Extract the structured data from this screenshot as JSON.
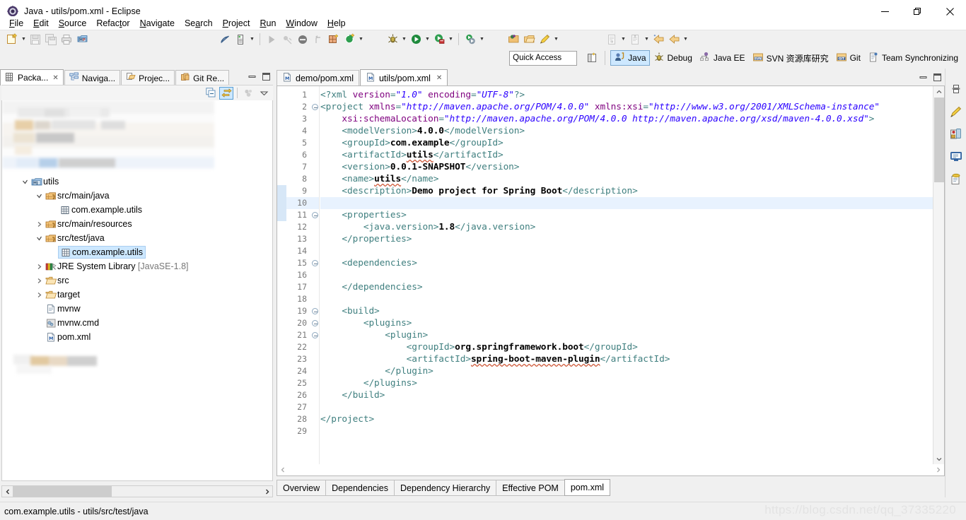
{
  "window": {
    "title": "Java - utils/pom.xml - Eclipse",
    "app_icon": "eclipse-icon",
    "controls": {
      "minimize": "—",
      "maximize": "❐",
      "close": "✕"
    }
  },
  "menubar": {
    "items": [
      {
        "label": "File",
        "mnemonic": "F"
      },
      {
        "label": "Edit",
        "mnemonic": "E"
      },
      {
        "label": "Source",
        "mnemonic": "S"
      },
      {
        "label": "Refactor",
        "mnemonic": "t"
      },
      {
        "label": "Navigate",
        "mnemonic": "N"
      },
      {
        "label": "Search",
        "mnemonic": "a"
      },
      {
        "label": "Project",
        "mnemonic": "P"
      },
      {
        "label": "Run",
        "mnemonic": "R"
      },
      {
        "label": "Window",
        "mnemonic": "W"
      },
      {
        "label": "Help",
        "mnemonic": "H"
      }
    ]
  },
  "toolbar": {
    "items": [
      "new-wizard-icon",
      "new-wizard-dropdown",
      "save-icon",
      "save-all-icon",
      "print-icon",
      "maven-build-icon",
      "toggle-breadcrumb-icon",
      "toggle-mark-occurrences-icon",
      "mark-occurrences-dropdown",
      "run-icon",
      "debug-last-icon",
      "terminate-icon",
      "skip-breakpoints-icon",
      "new-java-package-icon",
      "new-java-project-icon",
      "new-java-dropdown",
      "debug-icon",
      "debug-dropdown",
      "run-play-icon",
      "run-dropdown",
      "coverage-icon",
      "coverage-dropdown",
      "external-tools-icon",
      "external-tools-dropdown",
      "open-type-icon",
      "open-task-icon",
      "open-resource-icon",
      "search-dropdown",
      "next-annotation-icon",
      "next-annotation-dropdown",
      "previous-annotation-icon",
      "previous-annotation-dropdown",
      "back-icon",
      "forward-icon",
      "forward-dropdown"
    ]
  },
  "quick_access": {
    "placeholder": "Quick Access",
    "value": "Quick Access"
  },
  "perspectives": {
    "open_perspective_icon": "open-perspective-icon",
    "items": [
      {
        "label": "Java",
        "icon": "java-perspective-icon",
        "active": true
      },
      {
        "label": "Debug",
        "icon": "debug-perspective-icon",
        "active": false
      },
      {
        "label": "Java EE",
        "icon": "javaee-perspective-icon",
        "active": false
      },
      {
        "label": "SVN 资源库研究",
        "icon": "svn-perspective-icon",
        "active": false
      },
      {
        "label": "Git",
        "icon": "git-perspective-icon",
        "active": false
      },
      {
        "label": "Team Synchronizing",
        "icon": "team-sync-perspective-icon",
        "active": false
      }
    ]
  },
  "left_view": {
    "tabs": [
      {
        "label": "Packa...",
        "icon": "package-explorer-icon",
        "active": true,
        "closable": true
      },
      {
        "label": "Naviga...",
        "icon": "navigator-icon",
        "active": false,
        "closable": false
      },
      {
        "label": "Projec...",
        "icon": "project-explorer-icon",
        "active": false,
        "closable": false
      },
      {
        "label": "Git Re...",
        "icon": "git-repositories-icon",
        "active": false,
        "closable": false
      }
    ],
    "window_buttons": [
      "minimize-view-icon",
      "maximize-view-icon"
    ],
    "toolbar": [
      {
        "name": "collapse-all-icon",
        "active": false
      },
      {
        "name": "link-with-editor-icon",
        "active": true
      },
      {
        "name": "focus-on-active-task-icon",
        "active": false
      },
      {
        "name": "view-menu-icon",
        "active": false
      }
    ],
    "tree": [
      {
        "label": "utils",
        "icon": "maven-project-icon",
        "indent": 1,
        "expander": "expanded",
        "selected": false
      },
      {
        "label": "src/main/java",
        "icon": "source-folder-icon",
        "indent": 2,
        "expander": "expanded",
        "selected": false
      },
      {
        "label": "com.example.utils",
        "icon": "package-icon",
        "indent": 3,
        "expander": "none",
        "selected": false
      },
      {
        "label": "src/main/resources",
        "icon": "source-folder-icon",
        "indent": 2,
        "expander": "collapsed",
        "selected": false
      },
      {
        "label": "src/test/java",
        "icon": "source-folder-icon",
        "indent": 2,
        "expander": "expanded",
        "selected": false
      },
      {
        "label": "com.example.utils",
        "icon": "package-icon",
        "indent": 3,
        "expander": "none",
        "selected": true
      },
      {
        "label": "JRE System Library",
        "suffix": " [JavaSE-1.8]",
        "icon": "jre-library-icon",
        "indent": 2,
        "expander": "collapsed",
        "selected": false
      },
      {
        "label": "src",
        "icon": "folder-icon",
        "indent": 2,
        "expander": "collapsed",
        "selected": false
      },
      {
        "label": "target",
        "icon": "folder-icon",
        "indent": 2,
        "expander": "collapsed",
        "selected": false
      },
      {
        "label": "mvnw",
        "icon": "file-icon",
        "indent": 2,
        "expander": "none",
        "selected": false
      },
      {
        "label": "mvnw.cmd",
        "icon": "cmd-file-icon",
        "indent": 2,
        "expander": "none",
        "selected": false
      },
      {
        "label": "pom.xml",
        "icon": "maven-pom-icon",
        "indent": 2,
        "expander": "none",
        "selected": false
      }
    ],
    "hscroll": {
      "name": "horizontal-scrollbar",
      "left_arrow": "‹",
      "right_arrow": "›"
    }
  },
  "editor": {
    "tabs": [
      {
        "label": "demo/pom.xml",
        "icon": "maven-pom-icon",
        "active": false,
        "closable": false
      },
      {
        "label": "utils/pom.xml",
        "icon": "maven-pom-icon",
        "active": true,
        "closable": true
      }
    ],
    "window_buttons": [
      "minimize-editor-icon",
      "maximize-editor-icon"
    ],
    "current_line": 10,
    "lines": [
      {
        "n": 1,
        "fold": false,
        "tokens": [
          {
            "t": "pi",
            "v": "<?xml "
          },
          {
            "t": "attr",
            "v": "version"
          },
          {
            "t": "pi",
            "v": "="
          },
          {
            "t": "val",
            "v": "\"1.0\""
          },
          {
            "t": "pi",
            "v": " "
          },
          {
            "t": "attr",
            "v": "encoding"
          },
          {
            "t": "pi",
            "v": "="
          },
          {
            "t": "val",
            "v": "\"UTF-8\""
          },
          {
            "t": "pi",
            "v": "?>"
          }
        ]
      },
      {
        "n": 2,
        "fold": true,
        "tokens": [
          {
            "t": "tag",
            "v": "<project "
          },
          {
            "t": "attr",
            "v": "xmlns"
          },
          {
            "t": "tag",
            "v": "="
          },
          {
            "t": "val",
            "v": "\"http://maven.apache.org/POM/4.0.0\""
          },
          {
            "t": "tag",
            "v": " "
          },
          {
            "t": "attr",
            "v": "xmlns:xsi"
          },
          {
            "t": "tag",
            "v": "="
          },
          {
            "t": "val",
            "v": "\"http://www.w3.org/2001/XMLSchema-instance\""
          }
        ]
      },
      {
        "n": 3,
        "fold": false,
        "tokens": [
          {
            "t": "plain",
            "v": "    "
          },
          {
            "t": "attr",
            "v": "xsi:schemaLocation"
          },
          {
            "t": "tag",
            "v": "="
          },
          {
            "t": "val",
            "v": "\"http://maven.apache.org/POM/4.0.0 http://maven.apache.org/xsd/maven-4.0.0.xsd\""
          },
          {
            "t": "tag",
            "v": ">"
          }
        ]
      },
      {
        "n": 4,
        "fold": false,
        "tokens": [
          {
            "t": "plain",
            "v": "    "
          },
          {
            "t": "tag",
            "v": "<modelVersion>"
          },
          {
            "t": "txt",
            "v": "4.0.0"
          },
          {
            "t": "tag",
            "v": "</modelVersion>"
          }
        ]
      },
      {
        "n": 5,
        "fold": false,
        "tokens": [
          {
            "t": "plain",
            "v": "    "
          },
          {
            "t": "tag",
            "v": "<groupId>"
          },
          {
            "t": "txt",
            "v": "com.example"
          },
          {
            "t": "tag",
            "v": "</groupId>"
          }
        ]
      },
      {
        "n": 6,
        "fold": false,
        "tokens": [
          {
            "t": "plain",
            "v": "    "
          },
          {
            "t": "tag",
            "v": "<artifactId>"
          },
          {
            "t": "txt-spell",
            "v": "utils"
          },
          {
            "t": "tag",
            "v": "</artifactId>"
          }
        ]
      },
      {
        "n": 7,
        "fold": false,
        "tokens": [
          {
            "t": "plain",
            "v": "    "
          },
          {
            "t": "tag",
            "v": "<version>"
          },
          {
            "t": "txt",
            "v": "0.0.1-SNAPSHOT"
          },
          {
            "t": "tag",
            "v": "</version>"
          }
        ]
      },
      {
        "n": 8,
        "fold": false,
        "tokens": [
          {
            "t": "plain",
            "v": "    "
          },
          {
            "t": "tag",
            "v": "<name>"
          },
          {
            "t": "txt-spell",
            "v": "utils"
          },
          {
            "t": "tag",
            "v": "</name>"
          }
        ]
      },
      {
        "n": 9,
        "fold": false,
        "tokens": [
          {
            "t": "plain",
            "v": "    "
          },
          {
            "t": "tag",
            "v": "<description>"
          },
          {
            "t": "txt",
            "v": "Demo project for Spring Boot"
          },
          {
            "t": "tag",
            "v": "</description>"
          }
        ]
      },
      {
        "n": 10,
        "fold": false,
        "tokens": []
      },
      {
        "n": 11,
        "fold": true,
        "tokens": [
          {
            "t": "plain",
            "v": "    "
          },
          {
            "t": "tag",
            "v": "<properties>"
          }
        ]
      },
      {
        "n": 12,
        "fold": false,
        "tokens": [
          {
            "t": "plain",
            "v": "        "
          },
          {
            "t": "tag",
            "v": "<java.version>"
          },
          {
            "t": "txt",
            "v": "1.8"
          },
          {
            "t": "tag",
            "v": "</java.version>"
          }
        ]
      },
      {
        "n": 13,
        "fold": false,
        "tokens": [
          {
            "t": "plain",
            "v": "    "
          },
          {
            "t": "tag",
            "v": "</properties>"
          }
        ]
      },
      {
        "n": 14,
        "fold": false,
        "tokens": []
      },
      {
        "n": 15,
        "fold": true,
        "tokens": [
          {
            "t": "plain",
            "v": "    "
          },
          {
            "t": "tag",
            "v": "<dependencies>"
          }
        ]
      },
      {
        "n": 16,
        "fold": false,
        "tokens": []
      },
      {
        "n": 17,
        "fold": false,
        "tokens": [
          {
            "t": "plain",
            "v": "    "
          },
          {
            "t": "tag",
            "v": "</dependencies>"
          }
        ]
      },
      {
        "n": 18,
        "fold": false,
        "tokens": []
      },
      {
        "n": 19,
        "fold": true,
        "tokens": [
          {
            "t": "plain",
            "v": "    "
          },
          {
            "t": "tag",
            "v": "<build>"
          }
        ]
      },
      {
        "n": 20,
        "fold": true,
        "tokens": [
          {
            "t": "plain",
            "v": "        "
          },
          {
            "t": "tag",
            "v": "<plugins>"
          }
        ]
      },
      {
        "n": 21,
        "fold": true,
        "tokens": [
          {
            "t": "plain",
            "v": "            "
          },
          {
            "t": "tag",
            "v": "<plugin>"
          }
        ]
      },
      {
        "n": 22,
        "fold": false,
        "tokens": [
          {
            "t": "plain",
            "v": "                "
          },
          {
            "t": "tag",
            "v": "<groupId>"
          },
          {
            "t": "txt",
            "v": "org.springframework.boot"
          },
          {
            "t": "tag",
            "v": "</groupId>"
          }
        ]
      },
      {
        "n": 23,
        "fold": false,
        "tokens": [
          {
            "t": "plain",
            "v": "                "
          },
          {
            "t": "tag",
            "v": "<artifactId>"
          },
          {
            "t": "txt-spell",
            "v": "spring-boot-maven-plugin"
          },
          {
            "t": "tag",
            "v": "</artifactId>"
          }
        ]
      },
      {
        "n": 24,
        "fold": false,
        "tokens": [
          {
            "t": "plain",
            "v": "            "
          },
          {
            "t": "tag",
            "v": "</plugin>"
          }
        ]
      },
      {
        "n": 25,
        "fold": false,
        "tokens": [
          {
            "t": "plain",
            "v": "        "
          },
          {
            "t": "tag",
            "v": "</plugins>"
          }
        ]
      },
      {
        "n": 26,
        "fold": false,
        "tokens": [
          {
            "t": "plain",
            "v": "    "
          },
          {
            "t": "tag",
            "v": "</build>"
          }
        ]
      },
      {
        "n": 27,
        "fold": false,
        "tokens": []
      },
      {
        "n": 28,
        "fold": false,
        "tokens": [
          {
            "t": "tag",
            "v": "</project>"
          }
        ]
      },
      {
        "n": 29,
        "fold": false,
        "tokens": []
      }
    ],
    "form_tabs": [
      {
        "label": "Overview",
        "active": false
      },
      {
        "label": "Dependencies",
        "active": false
      },
      {
        "label": "Dependency Hierarchy",
        "active": false
      },
      {
        "label": "Effective POM",
        "active": false
      },
      {
        "label": "pom.xml",
        "active": true
      }
    ]
  },
  "right_trim": {
    "items": [
      "restore-icon",
      "javadoc-pen-icon",
      "snippets-icon",
      "console-icon",
      "properties-icon"
    ]
  },
  "statusbar": {
    "selection": "com.example.utils - utils/src/test/java"
  },
  "watermark": {
    "text": "https://blog.csdn.net/qq_37335220"
  },
  "colors": {
    "accent_selection": "#cde8ff",
    "current_line": "#e8f2fe",
    "tag": "#3f7f7f",
    "attribute": "#7f007f",
    "value": "#2a00ff",
    "text": "#000000",
    "chrome": "#f0f0f0",
    "spell_error": "#d05a3a"
  }
}
